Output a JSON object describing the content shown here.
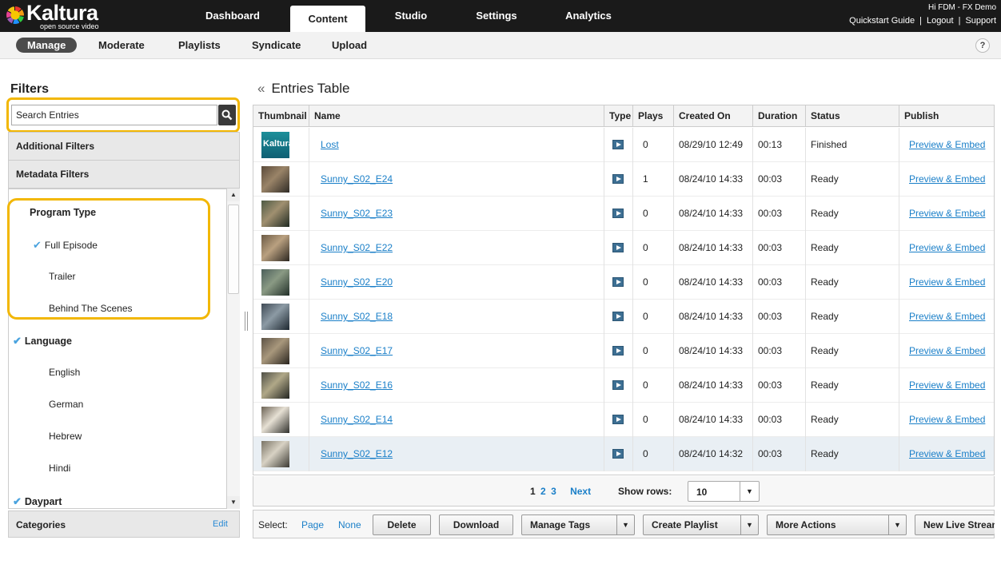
{
  "brand": {
    "name": "Kaltura",
    "tagline": "open source video"
  },
  "top_tabs": [
    {
      "label": "Dashboard",
      "active": false
    },
    {
      "label": "Content",
      "active": true
    },
    {
      "label": "Studio",
      "active": false
    },
    {
      "label": "Settings",
      "active": false
    },
    {
      "label": "Analytics",
      "active": false
    }
  ],
  "user": {
    "greeting": "Hi FDM - FX Demo",
    "links": [
      "Quickstart Guide",
      "Logout",
      "Support"
    ]
  },
  "sub_tabs": [
    {
      "label": "Manage",
      "active": true
    },
    {
      "label": "Moderate",
      "active": false
    },
    {
      "label": "Playlists",
      "active": false
    },
    {
      "label": "Syndicate",
      "active": false
    },
    {
      "label": "Upload",
      "active": false
    }
  ],
  "help_label": "?",
  "filters": {
    "title": "Filters",
    "search_placeholder": "Search Entries",
    "additional": "Additional Filters",
    "metadata": "Metadata Filters",
    "groups": [
      {
        "label": "Program Type",
        "checked": false,
        "items": [
          {
            "label": "Full Episode",
            "checked": true
          },
          {
            "label": "Trailer",
            "checked": false
          },
          {
            "label": "Behind The Scenes",
            "checked": false
          }
        ]
      },
      {
        "label": "Language",
        "checked": true,
        "items": [
          {
            "label": "English",
            "checked": false
          },
          {
            "label": "German",
            "checked": false
          },
          {
            "label": "Hebrew",
            "checked": false
          },
          {
            "label": "Hindi",
            "checked": false
          }
        ]
      },
      {
        "label": "Daypart",
        "checked": true,
        "items": []
      }
    ],
    "categories": "Categories",
    "edit": "Edit"
  },
  "entries": {
    "title": "Entries Table",
    "back_glyph": "«",
    "columns": [
      "Thumbnail",
      "Name",
      "Type",
      "Plays",
      "Created On",
      "Duration",
      "Status",
      "Publish"
    ],
    "rows": [
      {
        "name": "Lost",
        "plays": "0",
        "created": "08/29/10 12:49",
        "duration": "00:13",
        "status": "Finished",
        "publish": "Preview & Embed",
        "thumb": "kaltura"
      },
      {
        "name": "Sunny_S02_E24",
        "plays": "1",
        "created": "08/24/10 14:33",
        "duration": "00:03",
        "status": "Ready",
        "publish": "Preview & Embed",
        "thumb": "scene"
      },
      {
        "name": "Sunny_S02_E23",
        "plays": "0",
        "created": "08/24/10 14:33",
        "duration": "00:03",
        "status": "Ready",
        "publish": "Preview & Embed",
        "thumb": "scene"
      },
      {
        "name": "Sunny_S02_E22",
        "plays": "0",
        "created": "08/24/10 14:33",
        "duration": "00:03",
        "status": "Ready",
        "publish": "Preview & Embed",
        "thumb": "scene"
      },
      {
        "name": "Sunny_S02_E20",
        "plays": "0",
        "created": "08/24/10 14:33",
        "duration": "00:03",
        "status": "Ready",
        "publish": "Preview & Embed",
        "thumb": "scene"
      },
      {
        "name": "Sunny_S02_E18",
        "plays": "0",
        "created": "08/24/10 14:33",
        "duration": "00:03",
        "status": "Ready",
        "publish": "Preview & Embed",
        "thumb": "scene"
      },
      {
        "name": "Sunny_S02_E17",
        "plays": "0",
        "created": "08/24/10 14:33",
        "duration": "00:03",
        "status": "Ready",
        "publish": "Preview & Embed",
        "thumb": "scene"
      },
      {
        "name": "Sunny_S02_E16",
        "plays": "0",
        "created": "08/24/10 14:33",
        "duration": "00:03",
        "status": "Ready",
        "publish": "Preview & Embed",
        "thumb": "scene"
      },
      {
        "name": "Sunny_S02_E14",
        "plays": "0",
        "created": "08/24/10 14:33",
        "duration": "00:03",
        "status": "Ready",
        "publish": "Preview & Embed",
        "thumb": "scene"
      },
      {
        "name": "Sunny_S02_E12",
        "plays": "0",
        "created": "08/24/10 14:32",
        "duration": "00:03",
        "status": "Ready",
        "publish": "Preview & Embed",
        "thumb": "scene"
      }
    ]
  },
  "pager": {
    "current": "1",
    "pages": [
      "2",
      "3"
    ],
    "next": "Next",
    "show_rows_label": "Show rows:",
    "rows_value": "10"
  },
  "actions": {
    "select_label": "Select:",
    "page": "Page",
    "none": "None",
    "delete": "Delete",
    "download": "Download",
    "manage_tags": "Manage Tags",
    "create_playlist": "Create Playlist",
    "more_actions": "More Actions",
    "new_live": "New Live Stream"
  },
  "colors": {
    "highlight": "#f2b705",
    "link": "#1a7fc8",
    "check": "#4aa3df"
  }
}
